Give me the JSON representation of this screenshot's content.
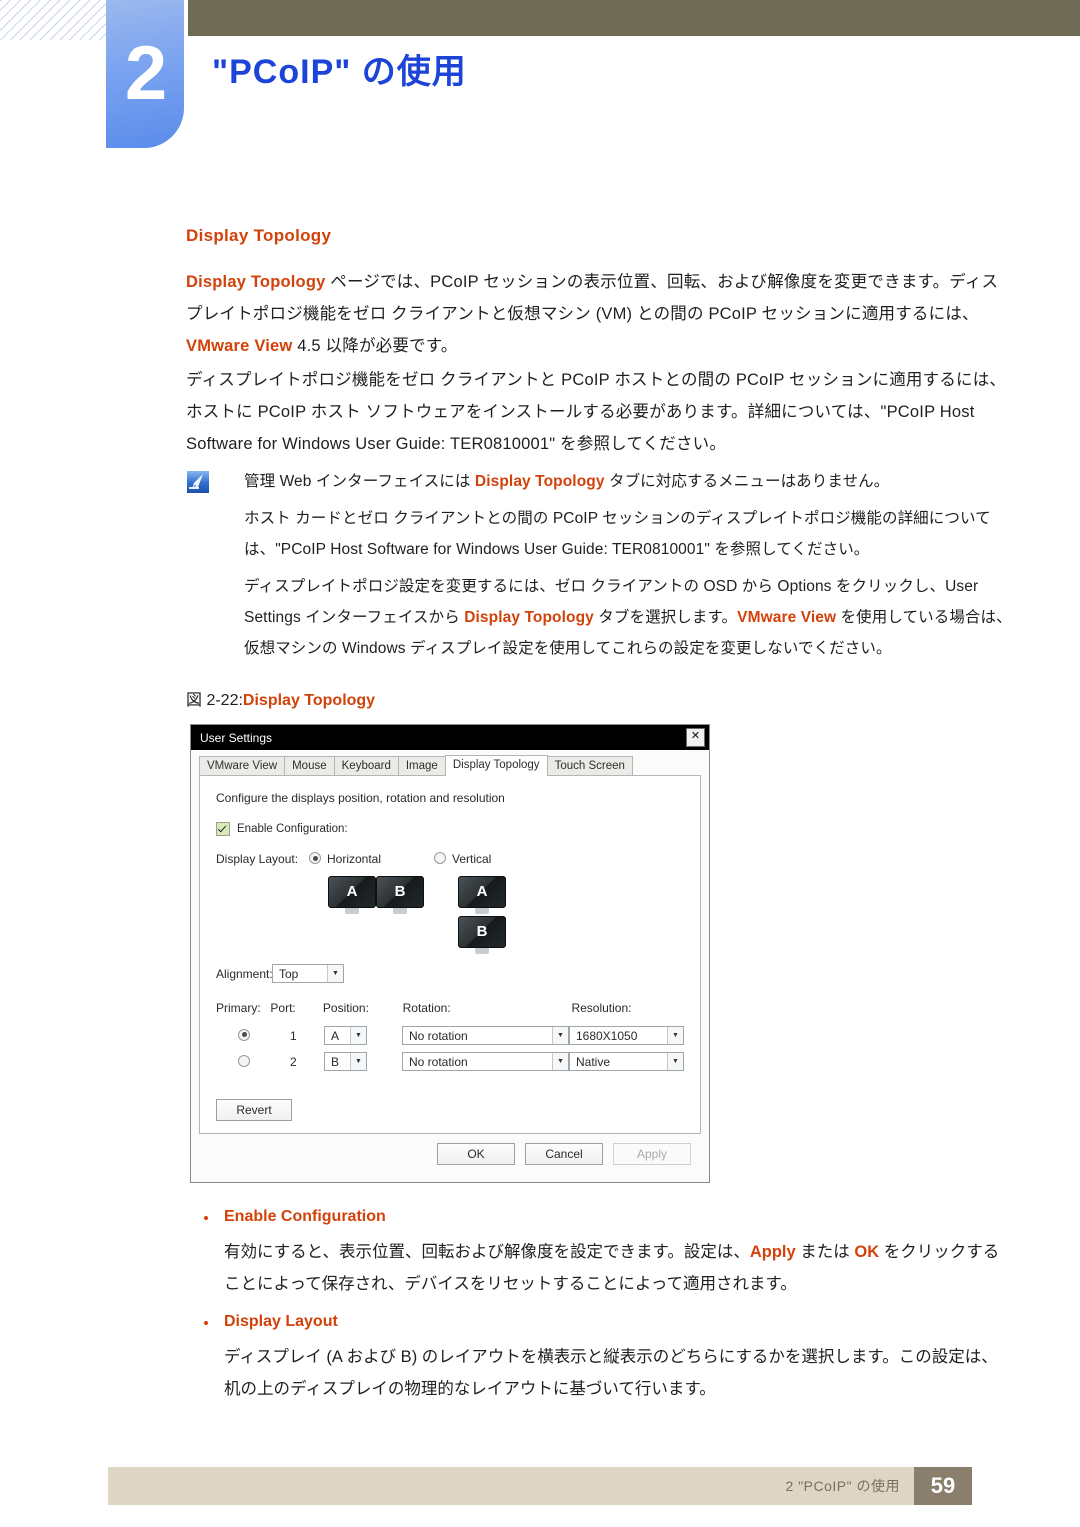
{
  "header": {
    "chapter_number": "2",
    "chapter_title": "\"PCoIP\" の使用"
  },
  "section": {
    "heading": "Display Topology",
    "paragraph1_a": "Display Topology",
    "paragraph1_b": " ページでは、PCoIP セッションの表示位置、回転、および解像度を変更できます。ディスプレイトポロジ機能をゼロ クライアントと仮想マシン (VM) との間の PCoIP セッションに適用するには、",
    "paragraph1_c": "VMware View",
    "paragraph1_d": " 4.5 以降が必要です。",
    "paragraph2": "ディスプレイトポロジ機能をゼロ クライアントと PCoIP ホストとの間の PCoIP セッションに適用するには、ホストに PCoIP ホスト ソフトウェアをインストールする必要があります。詳細については、\"PCoIP Host Software for Windows User Guide: TER0810001\" を参照してください。"
  },
  "note": {
    "icon": "note-quill-icon",
    "line1_a": "管理 Web インターフェイスには ",
    "line1_b": "Display Topology",
    "line1_c": " タブに対応するメニューはありません。",
    "line2": "ホスト カードとゼロ クライアントとの間の PCoIP セッションのディスプレイトポロジ機能の詳細については、\"PCoIP Host Software for Windows User Guide: TER0810001\" を参照してください。",
    "line3_a": "ディスプレイトポロジ設定を変更するには、ゼロ クライアントの OSD から Options をクリックし、User Settings インターフェイスから ",
    "line3_b": "Display Topology",
    "line3_c": " タブを選択します。",
    "line3_d": "VMware View",
    "line3_e": " を使用している場合は、仮想マシンの Windows ディスプレイ設定を使用してこれらの設定を変更しないでください。"
  },
  "figure": {
    "caption_prefix": "図 2-22:",
    "caption_title": "Display Topology"
  },
  "dialog": {
    "title": "User Settings",
    "close_label": "✕",
    "tabs": [
      {
        "label": "VMware View",
        "active": false
      },
      {
        "label": "Mouse",
        "active": false
      },
      {
        "label": "Keyboard",
        "active": false
      },
      {
        "label": "Image",
        "active": false
      },
      {
        "label": "Display Topology",
        "active": true
      },
      {
        "label": "Touch Screen",
        "active": false
      }
    ],
    "description": "Configure the displays position, rotation and resolution",
    "enable_configuration_label": "Enable Configuration:",
    "enable_configuration_checked": true,
    "display_layout_label": "Display Layout:",
    "layout_horizontal": "Horizontal",
    "layout_vertical": "Vertical",
    "layout_selected": "Horizontal",
    "monitor_a": "A",
    "monitor_b": "B",
    "alignment_label": "Alignment:",
    "alignment_value": "Top",
    "columns": {
      "primary": "Primary:",
      "port": "Port:",
      "position": "Position:",
      "rotation": "Rotation:",
      "resolution": "Resolution:"
    },
    "rows": [
      {
        "primary": true,
        "port": "1",
        "position": "A",
        "rotation": "No rotation",
        "resolution": "1680X1050"
      },
      {
        "primary": false,
        "port": "2",
        "position": "B",
        "rotation": "No rotation",
        "resolution": "Native"
      }
    ],
    "revert_label": "Revert",
    "ok_label": "OK",
    "cancel_label": "Cancel",
    "apply_label": "Apply",
    "apply_disabled": true
  },
  "bullets": [
    {
      "title": "Enable Configuration",
      "text_a": "有効にすると、表示位置、回転および解像度を設定できます。設定は、",
      "text_b": "Apply",
      "text_c": " または ",
      "text_d": "OK",
      "text_e": " をクリックすることによって保存され、デバイスをリセットすることによって適用されます。"
    },
    {
      "title": "Display Layout",
      "text_a": "ディスプレイ (A および B) のレイアウトを横表示と縦表示のどちらにするかを選択します。この設定は、机の上のディスプレイの物理的なレイアウトに基づいて行います。",
      "text_b": "",
      "text_c": "",
      "text_d": "",
      "text_e": ""
    }
  ],
  "footer": {
    "text": "2 \"PCoIP\" の使用",
    "page_number": "59"
  },
  "colors": {
    "accent_orange": "#d2420a",
    "chapter_blue": "#1c44d8",
    "header_band": "#6e6b55",
    "footer_bar": "#ddd6c4",
    "footer_page_box": "#8a7f6d"
  }
}
